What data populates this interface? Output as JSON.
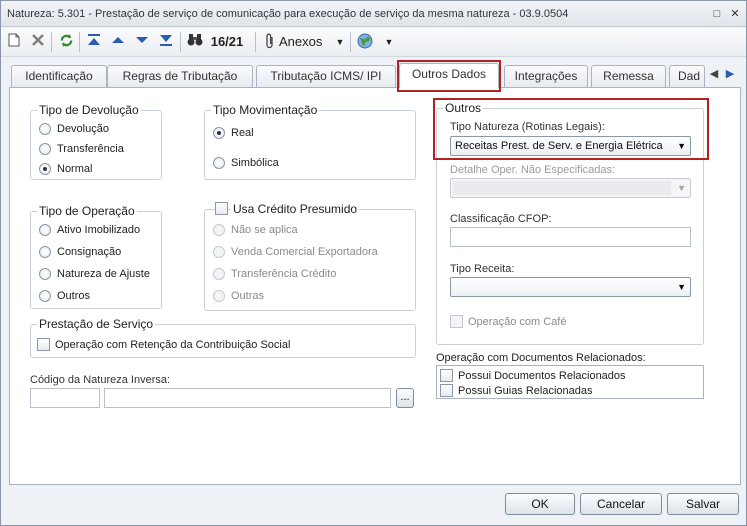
{
  "window": {
    "title": "Natureza: 5.301 - Prestação de serviço de comunicação para execução de serviço da mesma natureza - 03.9.0504",
    "controls": {
      "restore": "□",
      "close": "✕"
    }
  },
  "toolbar": {
    "record_counter": "16/21",
    "anexos_label": "Anexos",
    "icons": [
      "new-icon",
      "delete-icon",
      "refresh-icon",
      "first-record-icon",
      "previous-record-icon",
      "next-record-icon",
      "last-record-icon",
      "binoculars-icon",
      "paperclip-icon",
      "globe-icon"
    ]
  },
  "tabs": [
    {
      "label": "Identificação"
    },
    {
      "label": "Regras de Tributação"
    },
    {
      "label": "Tributação ICMS/ IPI"
    },
    {
      "label": "Outros Dados",
      "active": true
    },
    {
      "label": "Integrações"
    },
    {
      "label": "Remessa"
    },
    {
      "label": "Dad"
    }
  ],
  "tipo_devolucao": {
    "legend": "Tipo de Devolução",
    "options": [
      {
        "label": "Devolução",
        "selected": false
      },
      {
        "label": "Transferência",
        "selected": false
      },
      {
        "label": "Normal",
        "selected": true
      }
    ]
  },
  "tipo_movimentacao": {
    "legend": "Tipo Movimentação",
    "options": [
      {
        "label": "Real",
        "selected": true
      },
      {
        "label": "Simbólica",
        "selected": false
      }
    ]
  },
  "tipo_operacao": {
    "legend": "Tipo de Operação",
    "options": [
      {
        "label": "Ativo Imobilizado"
      },
      {
        "label": "Consignação"
      },
      {
        "label": "Natureza de Ajuste"
      },
      {
        "label": "Outros"
      }
    ]
  },
  "credito_presumido": {
    "checkbox_label": "Usa Crédito Presumido",
    "options": [
      {
        "label": "Não se aplica"
      },
      {
        "label": "Venda Comercial Exportadora"
      },
      {
        "label": "Transferência Crédito"
      },
      {
        "label": "Outras"
      }
    ]
  },
  "prestacao_servico": {
    "legend": "Prestação de Serviço",
    "checkbox_label": "Operação com Retenção da Contribuição Social"
  },
  "natureza_inversa": {
    "label": "Código da Natureza Inversa:",
    "lookup_button": "..."
  },
  "outros": {
    "legend": "Outros",
    "tipo_natureza_label": "Tipo Natureza (Rotinas Legais):",
    "tipo_natureza_value": "Receitas Prest. de Serv. e Energia Elétrica",
    "detalhe_label": "Detalhe Oper. Não Especificadas:",
    "classificacao_cfop_label": "Classificação CFOP:",
    "tipo_receita_label": "Tipo Receita:",
    "operacao_cafe_label": "Operação com Café"
  },
  "docs_relacionados": {
    "legend": "Operação com Documentos Relacionados:",
    "items": [
      {
        "label": "Possui Documentos Relacionados"
      },
      {
        "label": "Possui Guias Relacionadas"
      }
    ]
  },
  "buttons": {
    "ok": "OK",
    "cancel": "Cancelar",
    "save": "Salvar"
  }
}
